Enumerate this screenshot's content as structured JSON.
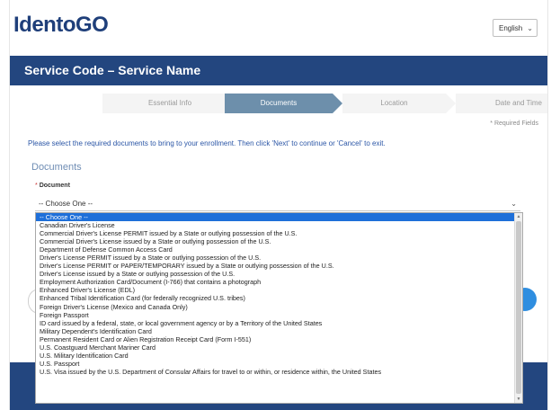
{
  "header": {
    "logo": "IdentoGO",
    "language": {
      "selected": "English"
    }
  },
  "title_bar": {
    "title": "Service Code – Service Name"
  },
  "steps": [
    {
      "label": "Essential Info",
      "active": false
    },
    {
      "label": "Documents",
      "active": true
    },
    {
      "label": "Location",
      "active": false
    },
    {
      "label": "Date and Time",
      "active": false
    }
  ],
  "required_note": "* Required Fields",
  "instructions": "Please select the required documents to bring to your enrollment. Then click 'Next' to continue or 'Cancel' to exit.",
  "section": {
    "title": "Documents",
    "field_label": "Document",
    "selected_value": "-- Choose One --"
  },
  "dropdown": {
    "options": [
      "-- Choose One --",
      "Canadian Driver's License",
      "Commercial Driver's License PERMIT issued by a State or outlying possession of the U.S.",
      "Commercial Driver's License issued by a State or outlying possession of the U.S.",
      "Department of Defense Common Access Card",
      "Driver's License PERMIT issued by a State or outlying possession of the U.S.",
      "Driver's License PERMIT or PAPER/TEMPORARY issued by a State or outlying possession of the U.S.",
      "Driver's License issued by a State or outlying possession of the U.S.",
      "Employment Authorization Card/Document (I-766) that contains a photograph",
      "Enhanced Driver's License (EDL)",
      "Enhanced Tribal Identification Card (for federally recognized U.S. tribes)",
      "Foreign Driver's License (Mexico and Canada Only)",
      "Foreign Passport",
      "ID card issued by a federal, state, or local government agency or by a Territory of the United States",
      "Military Dependent's Identification Card",
      "Permanent Resident Card or Alien Registration Receipt Card (Form I-551)",
      "U.S. Coastguard Merchant Mariner Card",
      "U.S. Military Identification Card",
      "U.S. Passport",
      "U.S. Visa issued by the U.S. Department of Consular Affairs for travel to or within, or residence within, the United States"
    ],
    "highlighted_index": 0
  },
  "colors": {
    "brand_navy": "#23467f",
    "step_active": "#6d8fab",
    "highlight": "#1e6fd9",
    "link_blue": "#2b56a6",
    "button_blue": "#2f8ee0"
  }
}
